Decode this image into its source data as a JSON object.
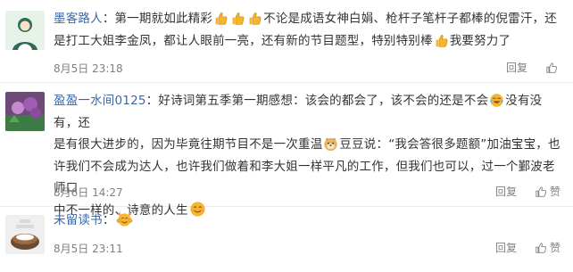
{
  "comments": [
    {
      "username": "墨客路人",
      "separator": "：",
      "lines": [
        [
          "第一期就如此精彩",
          "[thumbs-up]",
          "[thumbs-up]",
          "[thumbs-up]",
          "不论是成语女神白娟、枪杆子笔杆子都棒的倪雷汗，还"
        ],
        [
          "是打工大姐李金凤，都让人眼前一亮，还有新的节目题型，特别特别棒",
          "[thumbs-up]",
          "我要努力了"
        ]
      ],
      "time": "8月5日 23:18",
      "reply_label": "回复",
      "like_label": ""
    },
    {
      "username": "盈盈一水间0125",
      "separator": "：",
      "lines": [
        [
          "好诗词第五季第一期感想：该会的都会了，该不会的还是不会",
          "[laugh-cry]",
          "没有没有，还"
        ],
        [
          "是有很大进步的，因为毕竟往期节目不是一次重温",
          "[doge]",
          "豆豆说：“我会答很多题额”加油宝宝，也"
        ],
        [
          "许我们不会成为达人，也许我们做着和李大姐一样平凡的工作，但我们也可以，过一个鄞波老师口"
        ],
        [
          "中不一样的、诗意的人生",
          "[smile-blush]"
        ]
      ],
      "time": "8月6日 14:27",
      "reply_label": "回复",
      "like_label": "赞"
    },
    {
      "username": "未留读书",
      "separator": "：",
      "lines": [
        [
          "[cheer]"
        ]
      ],
      "time": "8月5日 23:11",
      "reply_label": "回复",
      "like_label": "赞"
    }
  ],
  "icons": {
    "thumbs-up": "thumbs-up-emoji-icon",
    "laugh-cry": "laughing-crying-emoji-icon",
    "doge": "doge-emoji-icon",
    "smile-blush": "blushing-smile-emoji-icon",
    "cheer": "cheering-emoji-icon",
    "like": "thumb-like-icon"
  },
  "colors": {
    "username": "#3b67a8",
    "text": "#333333",
    "meta": "#808080",
    "emoji": "#f5b531"
  }
}
